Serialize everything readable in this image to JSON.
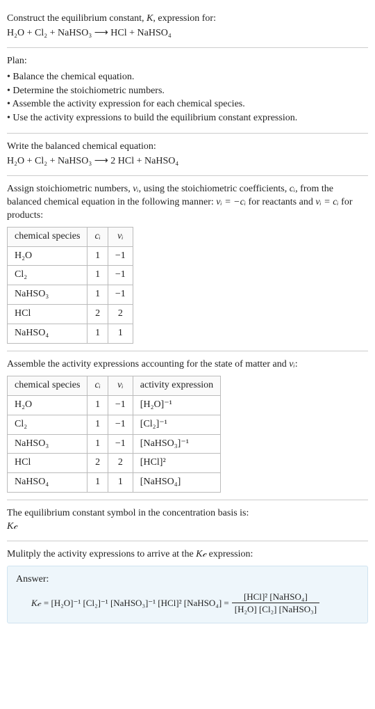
{
  "intro": {
    "prompt_prefix": "Construct the equilibrium constant, ",
    "prompt_k": "K",
    "prompt_suffix": ", expression for:",
    "equation": "H₂O + Cl₂ + NaHSO₃  ⟶  HCl + NaHSO₄"
  },
  "plan": {
    "heading": "Plan:",
    "items": [
      "• Balance the chemical equation.",
      "• Determine the stoichiometric numbers.",
      "• Assemble the activity expression for each chemical species.",
      "• Use the activity expressions to build the equilibrium constant expression."
    ]
  },
  "balanced": {
    "heading": "Write the balanced chemical equation:",
    "equation": "H₂O + Cl₂ + NaHSO₃  ⟶  2 HCl + NaHSO₄"
  },
  "stoich": {
    "heading_1": "Assign stoichiometric numbers, ",
    "nu": "νᵢ",
    "heading_2": ", using the stoichiometric coefficients, ",
    "ci": "cᵢ",
    "heading_3": ", from the balanced chemical equation in the following manner: ",
    "rule1": "νᵢ = −cᵢ",
    "heading_4": " for reactants and ",
    "rule2": "νᵢ = cᵢ",
    "heading_5": " for products:",
    "table": {
      "headers": [
        "chemical species",
        "cᵢ",
        "νᵢ"
      ],
      "rows": [
        [
          "H₂O",
          "1",
          "−1"
        ],
        [
          "Cl₂",
          "1",
          "−1"
        ],
        [
          "NaHSO₃",
          "1",
          "−1"
        ],
        [
          "HCl",
          "2",
          "2"
        ],
        [
          "NaHSO₄",
          "1",
          "1"
        ]
      ]
    }
  },
  "activity": {
    "heading_1": "Assemble the activity expressions accounting for the state of matter and ",
    "nu": "νᵢ",
    "heading_2": ":",
    "table": {
      "headers": [
        "chemical species",
        "cᵢ",
        "νᵢ",
        "activity expression"
      ],
      "rows": [
        [
          "H₂O",
          "1",
          "−1",
          "[H₂O]⁻¹"
        ],
        [
          "Cl₂",
          "1",
          "−1",
          "[Cl₂]⁻¹"
        ],
        [
          "NaHSO₃",
          "1",
          "−1",
          "[NaHSO₃]⁻¹"
        ],
        [
          "HCl",
          "2",
          "2",
          "[HCl]²"
        ],
        [
          "NaHSO₄",
          "1",
          "1",
          "[NaHSO₄]"
        ]
      ]
    }
  },
  "symbol": {
    "heading": "The equilibrium constant symbol in the concentration basis is:",
    "value": "K𝒸"
  },
  "multiply": {
    "heading_1": "Mulitply the activity expressions to arrive at the ",
    "kc": "K𝒸",
    "heading_2": " expression:"
  },
  "answer": {
    "label": "Answer:",
    "kc": "K𝒸",
    "lhs": " = [H₂O]⁻¹ [Cl₂]⁻¹ [NaHSO₃]⁻¹ [HCl]² [NaHSO₄] = ",
    "frac_num": "[HCl]² [NaHSO₄]",
    "frac_den": "[H₂O] [Cl₂] [NaHSO₃]"
  },
  "chart_data": {
    "type": "table",
    "tables": [
      {
        "title": "Stoichiometric numbers",
        "headers": [
          "chemical species",
          "c_i",
          "nu_i"
        ],
        "rows": [
          {
            "species": "H2O",
            "c_i": 1,
            "nu_i": -1
          },
          {
            "species": "Cl2",
            "c_i": 1,
            "nu_i": -1
          },
          {
            "species": "NaHSO3",
            "c_i": 1,
            "nu_i": -1
          },
          {
            "species": "HCl",
            "c_i": 2,
            "nu_i": 2
          },
          {
            "species": "NaHSO4",
            "c_i": 1,
            "nu_i": 1
          }
        ]
      },
      {
        "title": "Activity expressions",
        "headers": [
          "chemical species",
          "c_i",
          "nu_i",
          "activity expression"
        ],
        "rows": [
          {
            "species": "H2O",
            "c_i": 1,
            "nu_i": -1,
            "activity": "[H2O]^-1"
          },
          {
            "species": "Cl2",
            "c_i": 1,
            "nu_i": -1,
            "activity": "[Cl2]^-1"
          },
          {
            "species": "NaHSO3",
            "c_i": 1,
            "nu_i": -1,
            "activity": "[NaHSO3]^-1"
          },
          {
            "species": "HCl",
            "c_i": 2,
            "nu_i": 2,
            "activity": "[HCl]^2"
          },
          {
            "species": "NaHSO4",
            "c_i": 1,
            "nu_i": 1,
            "activity": "[NaHSO4]"
          }
        ]
      }
    ],
    "equilibrium_constant": "Kc = ([HCl]^2 [NaHSO4]) / ([H2O][Cl2][NaHSO3])"
  }
}
